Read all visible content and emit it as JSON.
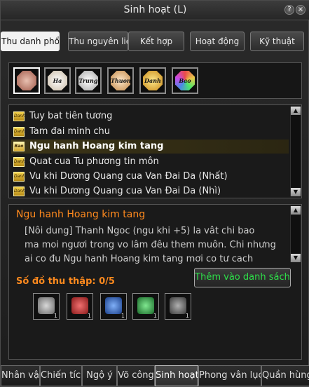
{
  "window": {
    "title": "Sinh hoạt (L)",
    "help_icon": "help-icon",
    "close_icon": "close-icon"
  },
  "tabs": [
    {
      "label": "Thu danh phổ"
    },
    {
      "label": "Thu nguyên liệ"
    },
    {
      "label": "Kết hợp"
    },
    {
      "label": "Hoạt động"
    },
    {
      "label": "Kỹ thuật"
    }
  ],
  "category_icons": [
    {
      "label": "",
      "icon": "all-category-icon",
      "color": "#c98a7a"
    },
    {
      "label": "Ha",
      "icon": "ha-category-icon",
      "color": "#e0d6c4"
    },
    {
      "label": "Trung",
      "icon": "trung-category-icon",
      "color": "#bdbdbd"
    },
    {
      "label": "Thuong",
      "icon": "thuong-category-icon",
      "color": "#d8a878"
    },
    {
      "label": "Danh",
      "icon": "danh-category-icon",
      "color": "#e6b84a"
    },
    {
      "label": "Bao",
      "icon": "bao-category-icon",
      "color": "#d9c44a"
    }
  ],
  "list": {
    "items": [
      {
        "label": "Tuy bat tiên tương",
        "badge": "Danh"
      },
      {
        "label": "Tam đai minh chu",
        "badge": "Danh"
      },
      {
        "label": "Ngu hanh Hoang kim tang",
        "badge": "Bao",
        "selected": true
      },
      {
        "label": "Quat cua Tu phương tin môn",
        "badge": "Danh"
      },
      {
        "label": "Vu khi Dương Quang cua Van Đai Da (Nhất)",
        "badge": "Danh"
      },
      {
        "label": "Vu khi Dương Quang cua Van Đai Da (Nhì)",
        "badge": "Danh"
      }
    ]
  },
  "detail": {
    "title": "Ngu hanh Hoang kim tang",
    "lines": [
      "[Nôi dung] Thanh Ngoc (ngu khi +5) la vât chi bao",
      "ma moi ngươi trong vo lâm đêu them muôn. Chi nhưng",
      "ai co đu Ngu hanh Hoang kim tang mơi co tư cach"
    ],
    "collect_label": "Số đồ thu thập: 0/5",
    "add_button": "Thêm vào danh sách",
    "slots": [
      {
        "icon": "gray-gem-icon",
        "qty": "1",
        "color": "#8a8a8a"
      },
      {
        "icon": "red-gem-icon",
        "qty": "1",
        "color": "#b52a2a"
      },
      {
        "icon": "blue-gem-icon",
        "qty": "1",
        "color": "#2a5fb5"
      },
      {
        "icon": "green-gem-icon",
        "qty": "1",
        "color": "#2a9b3c"
      },
      {
        "icon": "dark-gem-icon",
        "qty": "1",
        "color": "#5a5a5a"
      }
    ]
  },
  "bottom_tabs": [
    {
      "label": "Nhân vật"
    },
    {
      "label": "Chiến tích"
    },
    {
      "label": "Ngộ ý"
    },
    {
      "label": "Võ công"
    },
    {
      "label": "Sinh hoạt"
    },
    {
      "label": "Phong vân lục"
    },
    {
      "label": "Quần hùng"
    }
  ]
}
